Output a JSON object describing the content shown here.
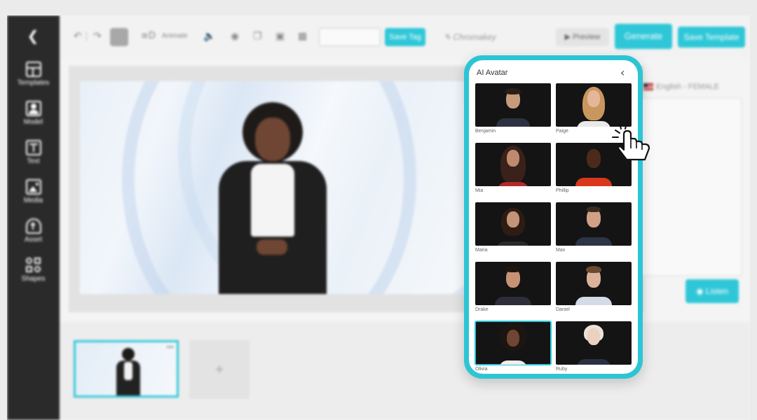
{
  "sidebar": {
    "items": [
      {
        "label": "Templates",
        "icon": "templates-icon"
      },
      {
        "label": "Model",
        "icon": "model-icon"
      },
      {
        "label": "Text",
        "icon": "text-icon"
      },
      {
        "label": "Media",
        "icon": "media-icon"
      },
      {
        "label": "Asset",
        "icon": "upload-icon"
      },
      {
        "label": "Shapes",
        "icon": "shapes-icon"
      }
    ]
  },
  "toolbar": {
    "animate_label": "Animate",
    "save_tag_label": "Save Tag",
    "chromakey_label": "Chromakey",
    "preview_label": "Preview",
    "generate_label": "Generate",
    "save_template_label": "Save Template"
  },
  "voice": {
    "language_label": "English - FEMALE",
    "listen_label": "Listen"
  },
  "colors": {
    "accent": "#2fc7d8",
    "sidebar_bg": "#2a2a2a"
  },
  "avatar_panel": {
    "title": "AI Avatar",
    "avatars": [
      {
        "name": "Benjamin"
      },
      {
        "name": "Paige"
      },
      {
        "name": "Mia"
      },
      {
        "name": "Phillip"
      },
      {
        "name": "Maria"
      },
      {
        "name": "Max"
      },
      {
        "name": "Drake"
      },
      {
        "name": "Daniel"
      },
      {
        "name": "Olivia",
        "selected": true
      },
      {
        "name": "Ruby"
      }
    ]
  }
}
